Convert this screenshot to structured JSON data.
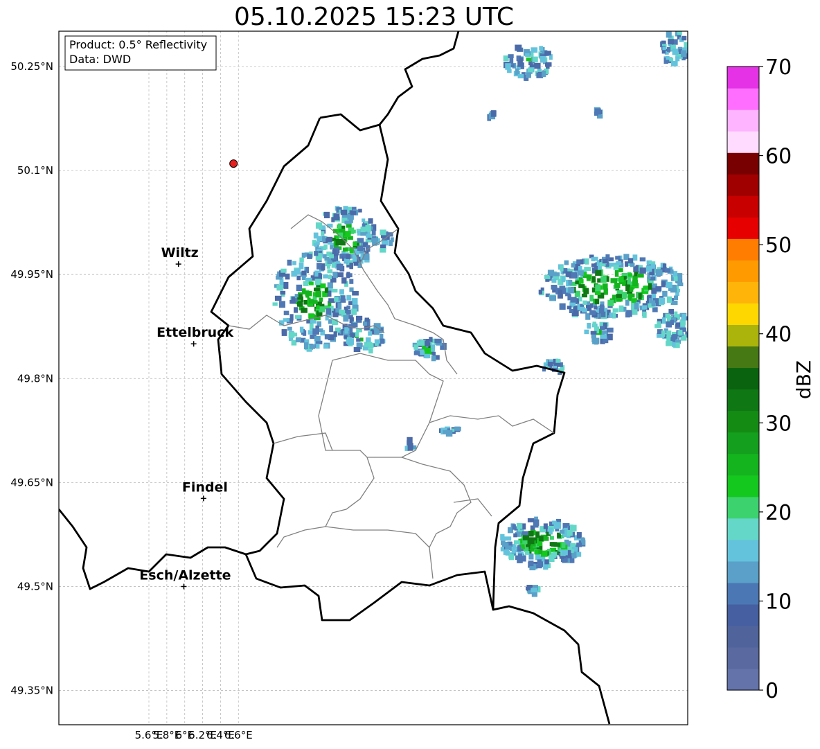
{
  "title": "05.10.2025 15:23 UTC",
  "info_box": {
    "product": "Product: 0.5° Reflectivity",
    "source": "Data: DWD"
  },
  "axes": {
    "lat_ticks": [
      "50.25°N",
      "50.1°N",
      "49.95°N",
      "49.8°N",
      "49.65°N",
      "49.5°N",
      "49.35°N"
    ],
    "lon_ticks": [
      "5.6°E",
      "5.8°E",
      "6°E",
      "6.2°E",
      "6.4°E",
      "6.6°E"
    ],
    "grid": true
  },
  "places": [
    {
      "name": "Wiltz",
      "lon": 5.93,
      "lat": 49.965
    },
    {
      "name": "Ettelbruck",
      "lon": 6.1,
      "lat": 49.85
    },
    {
      "name": "Findel",
      "lon": 6.21,
      "lat": 49.627
    },
    {
      "name": "Esch/Alzette",
      "lon": 5.99,
      "lat": 49.5
    }
  ],
  "marker": {
    "type": "radar-site",
    "color": "#e61e1e",
    "lon": 6.545,
    "lat": 50.11
  },
  "colorbar": {
    "label": "dBZ",
    "ticks": [
      "0",
      "10",
      "20",
      "30",
      "40",
      "50",
      "60",
      "70"
    ],
    "min": 0,
    "max": 70,
    "step": 2.5,
    "colors": [
      "#6473aa",
      "#5a69a0",
      "#50649b",
      "#465fa0",
      "#4b78b4",
      "#5aa0c8",
      "#64c3dc",
      "#64d7c8",
      "#3cd26e",
      "#14c81e",
      "#14b41e",
      "#14a01e",
      "#148c14",
      "#0f7814",
      "#0a640f",
      "#467814",
      "#aab40a",
      "#ffd700",
      "#ffb40a",
      "#ff9b00",
      "#ff7d00",
      "#e60000",
      "#c80000",
      "#a00000",
      "#780000",
      "#ffdcff",
      "#ffb4ff",
      "#ff6eff",
      "#e632e6"
    ]
  }
}
